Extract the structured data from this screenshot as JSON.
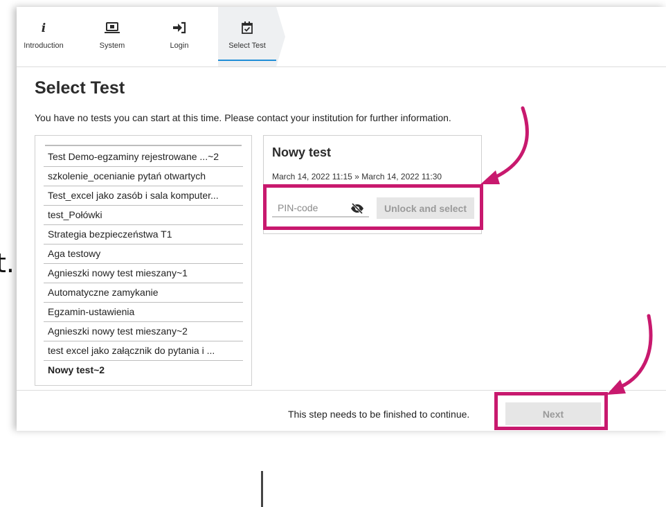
{
  "background_text": "t.",
  "wizard": {
    "steps": [
      {
        "label": "Introduction",
        "icon": "info-icon"
      },
      {
        "label": "System",
        "icon": "laptop-icon"
      },
      {
        "label": "Login",
        "icon": "login-arrow-icon"
      },
      {
        "label": "Select Test",
        "icon": "calendar-check-icon",
        "active": true
      }
    ]
  },
  "page": {
    "title": "Select Test",
    "info": "You have no tests you can start at this time. Please contact your institution for further information."
  },
  "tests": [
    "Test Demo-egzaminy rejestrowane ...~2",
    "szkolenie_ocenianie pytań otwartych",
    "Test_excel jako zasób i sala komputer...",
    "test_Połówki",
    "Strategia bezpieczeństwa T1",
    "Aga testowy",
    "Agnieszki nowy test mieszany~1",
    "Automatyczne zamykanie",
    "Egzamin-ustawienia",
    "Agnieszki nowy test mieszany~2",
    "test excel jako załącznik do pytania i ...",
    "Nowy test~2"
  ],
  "selected_test_index": 11,
  "detail": {
    "title": "Nowy test",
    "date_range": "March 14, 2022 11:15 » March 14, 2022 11:30",
    "pin_placeholder": "PIN-code",
    "pin_value": "",
    "unlock_label": "Unlock and select"
  },
  "footer": {
    "message": "This step needs to be finished to continue.",
    "next_label": "Next"
  },
  "colors": {
    "accent": "#1f8ed6",
    "highlight": "#c8196e",
    "disabled_bg": "#e6e6e6",
    "disabled_text": "#9a9a9a"
  }
}
